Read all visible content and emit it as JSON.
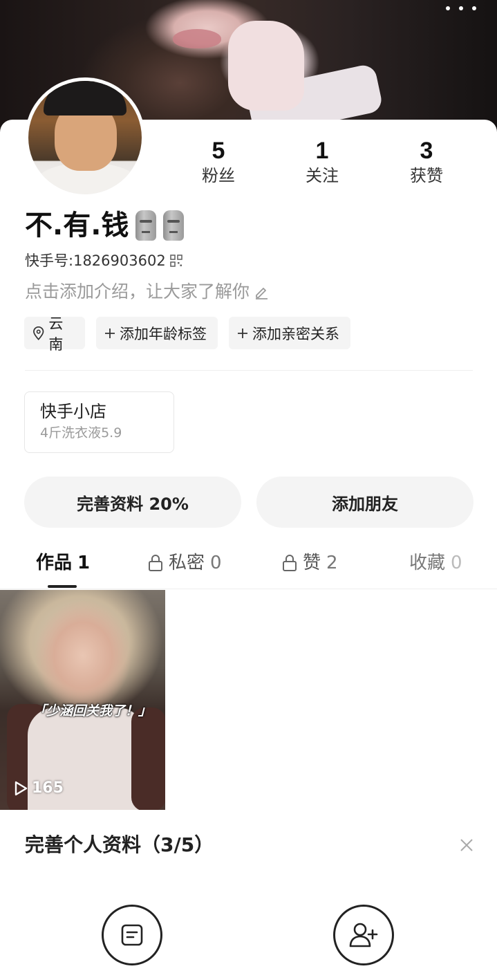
{
  "header": {
    "more_icon": "more-horizontal-icon"
  },
  "profile": {
    "username": "不.有.钱",
    "emoji_icon": "moai-icon",
    "kwai_id_label": "快手号: ",
    "kwai_id": "1826903602",
    "bio_placeholder": "点击添加介绍，让大家了解你"
  },
  "stats": [
    {
      "value": "5",
      "label": "粉丝"
    },
    {
      "value": "1",
      "label": "关注"
    },
    {
      "value": "3",
      "label": "获赞"
    }
  ],
  "tags": [
    {
      "icon": "location-pin-icon",
      "label": "云南"
    },
    {
      "icon": "plus-icon",
      "label": "添加年龄标签"
    },
    {
      "icon": "plus-icon",
      "label": "添加亲密关系"
    }
  ],
  "shop": {
    "title": "快手小店",
    "subtitle": "4斤洗衣液5.9"
  },
  "actions": {
    "complete_profile": "完善资料 20%",
    "add_friend": "添加朋友"
  },
  "tabs": [
    {
      "label": "作品",
      "count": "1",
      "active": true
    },
    {
      "label": "私密",
      "count": "0",
      "locked": true
    },
    {
      "label": "赞",
      "count": "2",
      "locked": true
    },
    {
      "label": "收藏",
      "count": "0"
    }
  ],
  "works": [
    {
      "caption": "「少涵回关我了！」",
      "plays": "165"
    }
  ],
  "completion_panel": {
    "title": "完善个人资料（3/5）",
    "items": [
      {
        "icon": "document-icon"
      },
      {
        "icon": "add-user-icon"
      }
    ]
  },
  "colors": {
    "text_primary": "#222222",
    "text_muted": "#9a9a9a",
    "chip_bg": "#f4f4f4"
  }
}
